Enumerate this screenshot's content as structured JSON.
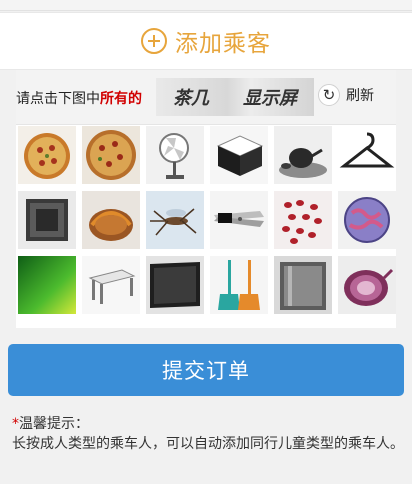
{
  "add_passenger": {
    "label": "添加乘客",
    "icon": "plus-circle-icon",
    "accent": "#e7a53c"
  },
  "captcha": {
    "prompt_prefix": "请点击下图中",
    "prompt_emphasis": "所有的",
    "keywords": [
      "茶几",
      "显示屏"
    ],
    "refresh_label": "刷新",
    "refresh_icon": "refresh-icon",
    "images": [
      "pizza",
      "pizza",
      "fan",
      "box",
      "tea-set",
      "hanger",
      "box",
      "basket",
      "mosquito",
      "scissors",
      "red-beans",
      "globe",
      "green-screen",
      "coffee-table",
      "monitor",
      "brooms",
      "trash-bin",
      "onion"
    ]
  },
  "submit": {
    "label": "提交订单",
    "color": "#3a8ed7"
  },
  "tips": {
    "marker": "*",
    "title": "温馨提示：",
    "text": "长按成人类型的乘车人，可以自动添加同行儿童类型的乘车人。"
  }
}
